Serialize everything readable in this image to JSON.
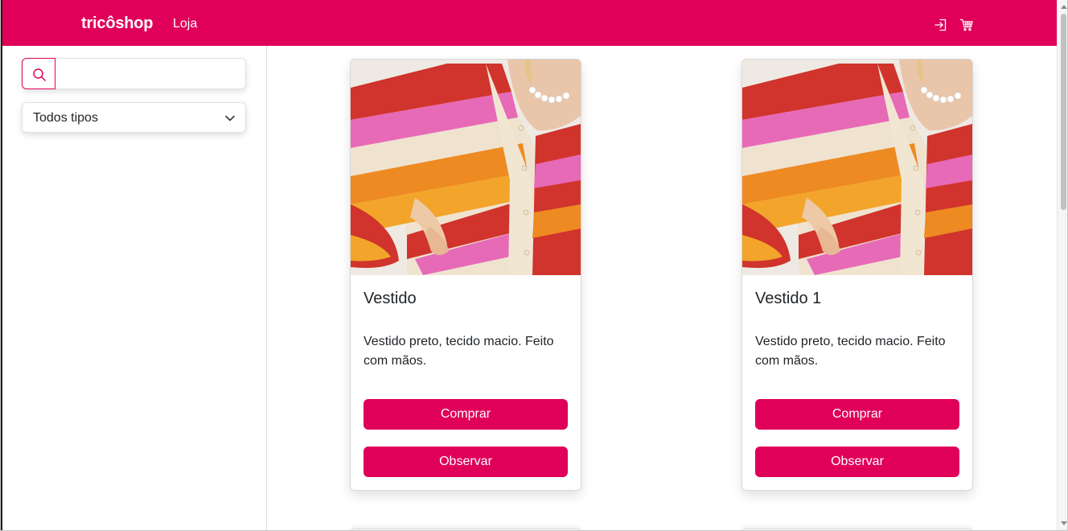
{
  "navbar": {
    "brand": "tricôshop",
    "link_store": "Loja",
    "icons": [
      "login-icon",
      "cart-icon"
    ]
  },
  "sidebar": {
    "search": {
      "value": "",
      "placeholder": ""
    },
    "type_filter": {
      "selected": "Todos tipos"
    }
  },
  "products": [
    {
      "title": "Vestido",
      "description": "Vestido preto, tecido macio. Feito com mãos.",
      "buy_label": "Comprar",
      "view_label": "Observar"
    },
    {
      "title": "Vestido 1",
      "description": "Vestido preto, tecido macio. Feito com mãos.",
      "buy_label": "Comprar",
      "view_label": "Observar"
    }
  ],
  "colors": {
    "brand": "#e0005a",
    "text": "#212529"
  }
}
